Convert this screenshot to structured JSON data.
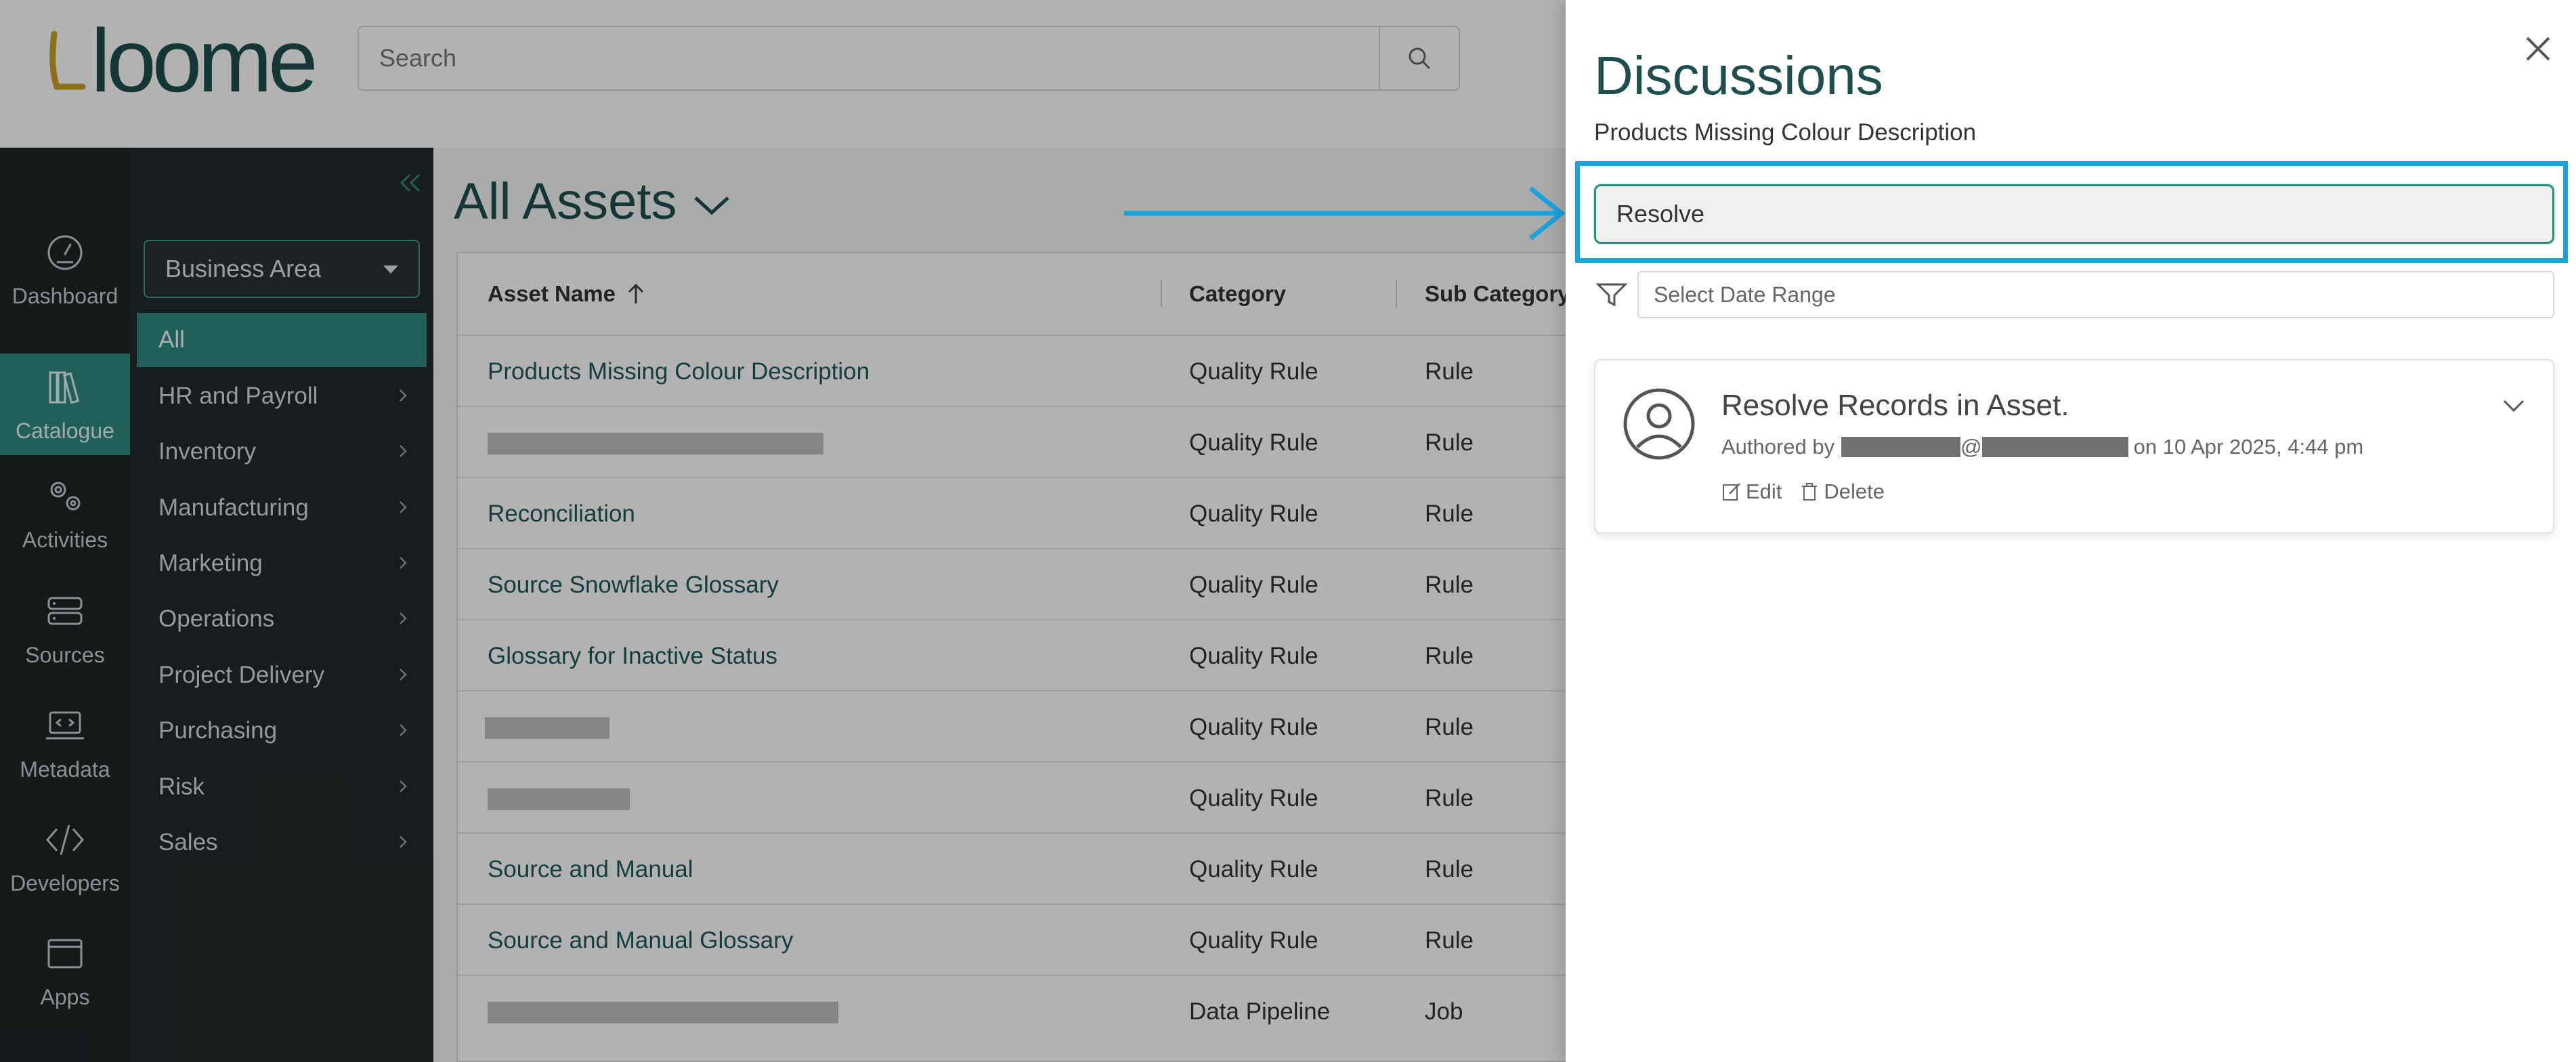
{
  "header": {
    "logo_text": "loome",
    "search_placeholder": "Search"
  },
  "rail": {
    "items": [
      {
        "label": "Dashboard",
        "icon": "dashboard-gauge-icon"
      },
      {
        "label": "Catalogue",
        "icon": "books-icon",
        "active": true
      },
      {
        "label": "Activities",
        "icon": "gears-icon"
      },
      {
        "label": "Sources",
        "icon": "servers-icon"
      },
      {
        "label": "Metadata",
        "icon": "laptop-code-icon"
      },
      {
        "label": "Developers",
        "icon": "code-brackets-icon"
      },
      {
        "label": "Apps",
        "icon": "window-icon"
      }
    ]
  },
  "catbar": {
    "business_area_label": "Business Area",
    "items": [
      {
        "label": "All",
        "active": true
      },
      {
        "label": "HR and Payroll"
      },
      {
        "label": "Inventory"
      },
      {
        "label": "Manufacturing"
      },
      {
        "label": "Marketing"
      },
      {
        "label": "Operations"
      },
      {
        "label": "Project Delivery"
      },
      {
        "label": "Purchasing"
      },
      {
        "label": "Risk"
      },
      {
        "label": "Sales"
      }
    ]
  },
  "main": {
    "title": "All Assets",
    "columns": [
      "Asset Name",
      "Category",
      "Sub Category"
    ],
    "rows": [
      {
        "name": "Products Missing Colour Description",
        "category": "Quality Rule",
        "sub": "Rule"
      },
      {
        "name": "",
        "redacted": true,
        "category": "Quality Rule",
        "sub": "Rule"
      },
      {
        "name": "Reconciliation",
        "category": "Quality Rule",
        "sub": "Rule"
      },
      {
        "name": "Source Snowflake Glossary",
        "category": "Quality Rule",
        "sub": "Rule"
      },
      {
        "name": "Glossary for Inactive Status",
        "category": "Quality Rule",
        "sub": "Rule"
      },
      {
        "name": "",
        "redacted": true,
        "category": "Quality Rule",
        "sub": "Rule"
      },
      {
        "name": "",
        "redacted": true,
        "category": "Quality Rule",
        "sub": "Rule"
      },
      {
        "name": "Source and Manual",
        "category": "Quality Rule",
        "sub": "Rule"
      },
      {
        "name": "Source and Manual Glossary",
        "category": "Quality Rule",
        "sub": "Rule"
      },
      {
        "name": "",
        "redacted": true,
        "category": "Data Pipeline",
        "sub": "Job"
      }
    ]
  },
  "panel": {
    "title": "Discussions",
    "subtitle": "Products Missing Colour Description",
    "search_value": "Resolve",
    "date_range_placeholder": "Select Date Range",
    "discussion": {
      "title": "Resolve Records in Asset.",
      "authored_by": "Authored by",
      "at_sign": "@",
      "date_text": "on 10 Apr 2025, 4:44 pm",
      "edit_label": "Edit",
      "delete_label": "Delete"
    }
  },
  "colors": {
    "accent_teal": "#2f8a80",
    "brand_dark": "#1e4f4e",
    "highlight_blue": "#1aa3dc"
  }
}
